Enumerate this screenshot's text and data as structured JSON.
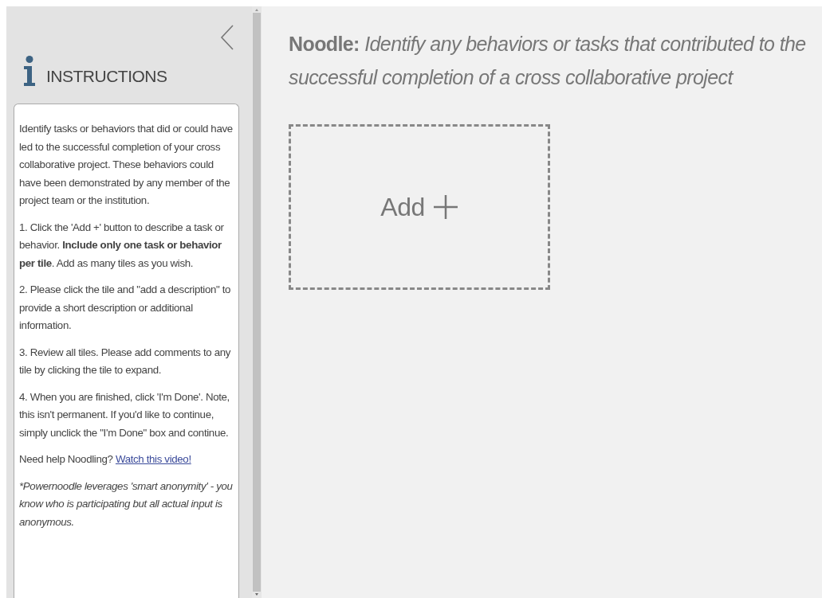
{
  "sidebar": {
    "title": "INSTRUCTIONS",
    "paragraphs": [
      {
        "kind": "text",
        "text": "Identify tasks or behaviors that did or could have led to the successful completion of your cross collaborative project. These behaviors could have been demonstrated by any member of the project team or the institution."
      },
      {
        "kind": "text",
        "text": "1. Click the 'Add +' button to describe a task or behavior. **Include only one task or behavior per tile**. Add as many tiles as you wish."
      },
      {
        "kind": "text",
        "text": "2. Please click the tile and \"add a description\" to provide a short description or additional information."
      },
      {
        "kind": "text",
        "text": "3. Review all tiles. Please add comments to any tile by clicking the tile to expand."
      },
      {
        "kind": "text",
        "text": "4. When you are finished, click 'I'm Done'. Note, this isn't permanent. If you'd like to continue, simply unclick the \"I'm Done\" box and continue."
      },
      {
        "kind": "link",
        "text": "Need help Noodling?",
        "link": "Watch this video!"
      },
      {
        "kind": "note",
        "text": "*Powernoodle leverages 'smart anonymity' - you know who is participating but all actual input is anonymous."
      }
    ]
  },
  "main": {
    "heading": "**Noodle:** Identify any behaviors or tasks that contributed to the successful completion of a cross collaborative project",
    "add_tile": {
      "label": "Add"
    }
  }
}
